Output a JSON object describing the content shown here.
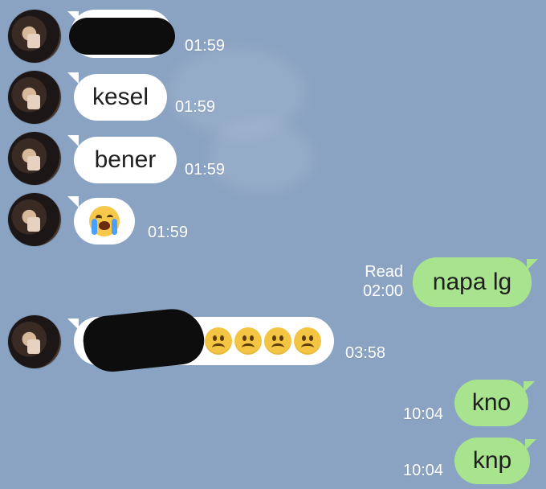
{
  "messages": [
    {
      "id": "m1",
      "dir": "in",
      "text": "",
      "redacted": true,
      "time": "01:59"
    },
    {
      "id": "m2",
      "dir": "in",
      "text": "kesel",
      "time": "01:59"
    },
    {
      "id": "m3",
      "dir": "in",
      "text": "bener",
      "time": "01:59"
    },
    {
      "id": "m4",
      "dir": "in",
      "emoji": "loudly-crying-face",
      "time": "01:59"
    },
    {
      "id": "m5",
      "dir": "out",
      "text": "napa lg",
      "status": "Read",
      "time": "02:00"
    },
    {
      "id": "m6",
      "dir": "in",
      "text": "",
      "redacted": true,
      "emoji": [
        "frowning-face",
        "frowning-face",
        "frowning-face",
        "frowning-face"
      ],
      "time": "03:58"
    },
    {
      "id": "m7",
      "dir": "out",
      "text": "kno",
      "time": "10:04"
    },
    {
      "id": "m8",
      "dir": "out",
      "text": "knp",
      "time": "10:04"
    }
  ],
  "colors": {
    "background": "#8aa3c2",
    "incoming_bubble": "#ffffff",
    "outgoing_bubble": "#a7e48d",
    "timestamp": "#ffffff"
  }
}
